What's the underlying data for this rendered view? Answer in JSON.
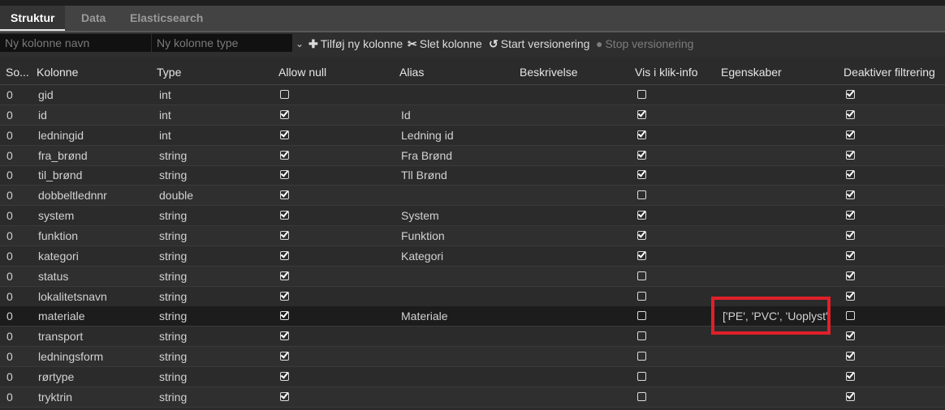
{
  "tabs": [
    {
      "label": "Struktur",
      "active": true
    },
    {
      "label": "Data",
      "active": false
    },
    {
      "label": "Elasticsearch",
      "active": false
    }
  ],
  "toolbar": {
    "new_column_name_placeholder": "Ny kolonne navn",
    "new_column_type_placeholder": "Ny kolonne type",
    "add_column_label": "Tilføj ny kolonne",
    "delete_column_label": "Slet kolonne",
    "start_versioning_label": "Start versionering",
    "stop_versioning_label": "Stop versionering"
  },
  "columns": [
    "So...",
    "Kolonne",
    "Type",
    "Allow null",
    "Alias",
    "Beskrivelse",
    "Vis i klik-info",
    "Egenskaber",
    "Deaktiver filtrering"
  ],
  "rows": [
    {
      "sort": "0",
      "kolonne": "gid",
      "type": "int",
      "allow_null": false,
      "alias": "",
      "beskrivelse": "",
      "vis_i_klik_info": false,
      "egenskaber": "",
      "deaktiver_filtrering": true
    },
    {
      "sort": "0",
      "kolonne": "id",
      "type": "int",
      "allow_null": true,
      "alias": "Id",
      "beskrivelse": "",
      "vis_i_klik_info": true,
      "egenskaber": "",
      "deaktiver_filtrering": true
    },
    {
      "sort": "0",
      "kolonne": "ledningid",
      "type": "int",
      "allow_null": true,
      "alias": "Ledning id",
      "beskrivelse": "",
      "vis_i_klik_info": true,
      "egenskaber": "",
      "deaktiver_filtrering": true
    },
    {
      "sort": "0",
      "kolonne": "fra_brønd",
      "type": "string",
      "allow_null": true,
      "alias": "Fra Brønd",
      "beskrivelse": "",
      "vis_i_klik_info": true,
      "egenskaber": "",
      "deaktiver_filtrering": true
    },
    {
      "sort": "0",
      "kolonne": "til_brønd",
      "type": "string",
      "allow_null": true,
      "alias": "Tll Brønd",
      "beskrivelse": "",
      "vis_i_klik_info": true,
      "egenskaber": "",
      "deaktiver_filtrering": true
    },
    {
      "sort": "0",
      "kolonne": "dobbeltlednnr",
      "type": "double",
      "allow_null": true,
      "alias": "",
      "beskrivelse": "",
      "vis_i_klik_info": false,
      "egenskaber": "",
      "deaktiver_filtrering": true
    },
    {
      "sort": "0",
      "kolonne": "system",
      "type": "string",
      "allow_null": true,
      "alias": "System",
      "beskrivelse": "",
      "vis_i_klik_info": true,
      "egenskaber": "",
      "deaktiver_filtrering": true
    },
    {
      "sort": "0",
      "kolonne": "funktion",
      "type": "string",
      "allow_null": true,
      "alias": "Funktion",
      "beskrivelse": "",
      "vis_i_klik_info": true,
      "egenskaber": "",
      "deaktiver_filtrering": true
    },
    {
      "sort": "0",
      "kolonne": "kategori",
      "type": "string",
      "allow_null": true,
      "alias": "Kategori",
      "beskrivelse": "",
      "vis_i_klik_info": true,
      "egenskaber": "",
      "deaktiver_filtrering": true
    },
    {
      "sort": "0",
      "kolonne": "status",
      "type": "string",
      "allow_null": true,
      "alias": "",
      "beskrivelse": "",
      "vis_i_klik_info": false,
      "egenskaber": "",
      "deaktiver_filtrering": true
    },
    {
      "sort": "0",
      "kolonne": "lokalitetsnavn",
      "type": "string",
      "allow_null": true,
      "alias": "",
      "beskrivelse": "",
      "vis_i_klik_info": false,
      "egenskaber": "",
      "deaktiver_filtrering": true
    },
    {
      "sort": "0",
      "kolonne": "materiale",
      "type": "string",
      "allow_null": true,
      "alias": "Materiale",
      "beskrivelse": "",
      "vis_i_klik_info": false,
      "egenskaber": "['PE', 'PVC', 'Uoplyst']",
      "deaktiver_filtrering": false,
      "selected": true
    },
    {
      "sort": "0",
      "kolonne": "transport",
      "type": "string",
      "allow_null": true,
      "alias": "",
      "beskrivelse": "",
      "vis_i_klik_info": false,
      "egenskaber": "",
      "deaktiver_filtrering": true
    },
    {
      "sort": "0",
      "kolonne": "ledningsform",
      "type": "string",
      "allow_null": true,
      "alias": "",
      "beskrivelse": "",
      "vis_i_klik_info": false,
      "egenskaber": "",
      "deaktiver_filtrering": true
    },
    {
      "sort": "0",
      "kolonne": "rørtype",
      "type": "string",
      "allow_null": true,
      "alias": "",
      "beskrivelse": "",
      "vis_i_klik_info": false,
      "egenskaber": "",
      "deaktiver_filtrering": true
    },
    {
      "sort": "0",
      "kolonne": "tryktrin",
      "type": "string",
      "allow_null": true,
      "alias": "",
      "beskrivelse": "",
      "vis_i_klik_info": false,
      "egenskaber": "",
      "deaktiver_filtrering": true
    }
  ],
  "colors": {
    "highlight": "#e0202a",
    "background": "#2b2b2b",
    "selected_row": "#1c1c1c"
  }
}
